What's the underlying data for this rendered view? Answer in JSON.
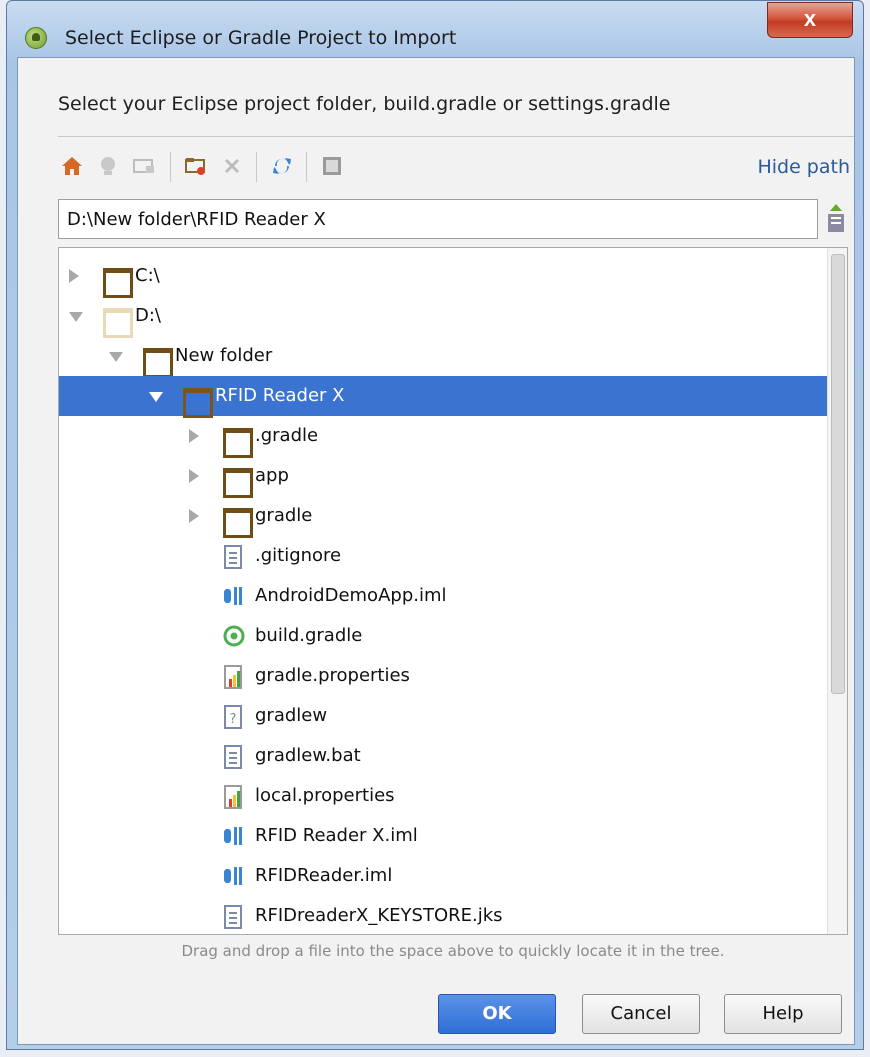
{
  "window": {
    "title": "Select Eclipse or Gradle Project to Import",
    "close_label": "x"
  },
  "description": "Select your Eclipse project folder, build.gradle or settings.gradle",
  "toolbar": {
    "hide_path_label": "Hide path"
  },
  "path": {
    "value": "D:\\New folder\\RFID Reader X"
  },
  "tree": {
    "rows": [
      {
        "label": "C:\\"
      },
      {
        "label": "D:\\"
      },
      {
        "label": "New folder"
      },
      {
        "label": "RFID Reader X"
      },
      {
        "label": ".gradle"
      },
      {
        "label": "app"
      },
      {
        "label": "gradle"
      },
      {
        "label": ".gitignore"
      },
      {
        "label": "AndroidDemoApp.iml"
      },
      {
        "label": "build.gradle"
      },
      {
        "label": "gradle.properties"
      },
      {
        "label": "gradlew"
      },
      {
        "label": "gradlew.bat"
      },
      {
        "label": "local.properties"
      },
      {
        "label": "RFID Reader X.iml"
      },
      {
        "label": "RFIDReader.iml"
      },
      {
        "label": "RFIDreaderX_KEYSTORE.jks"
      }
    ],
    "selected": "RFID Reader X"
  },
  "hint": "Drag and drop a file into the space above to quickly locate it in the tree.",
  "buttons": {
    "ok": "OK",
    "cancel": "Cancel",
    "help": "Help"
  },
  "colors": {
    "selection": "#3a73d0",
    "link": "#2a5a9e",
    "primary_button": "#2f6fd6"
  }
}
